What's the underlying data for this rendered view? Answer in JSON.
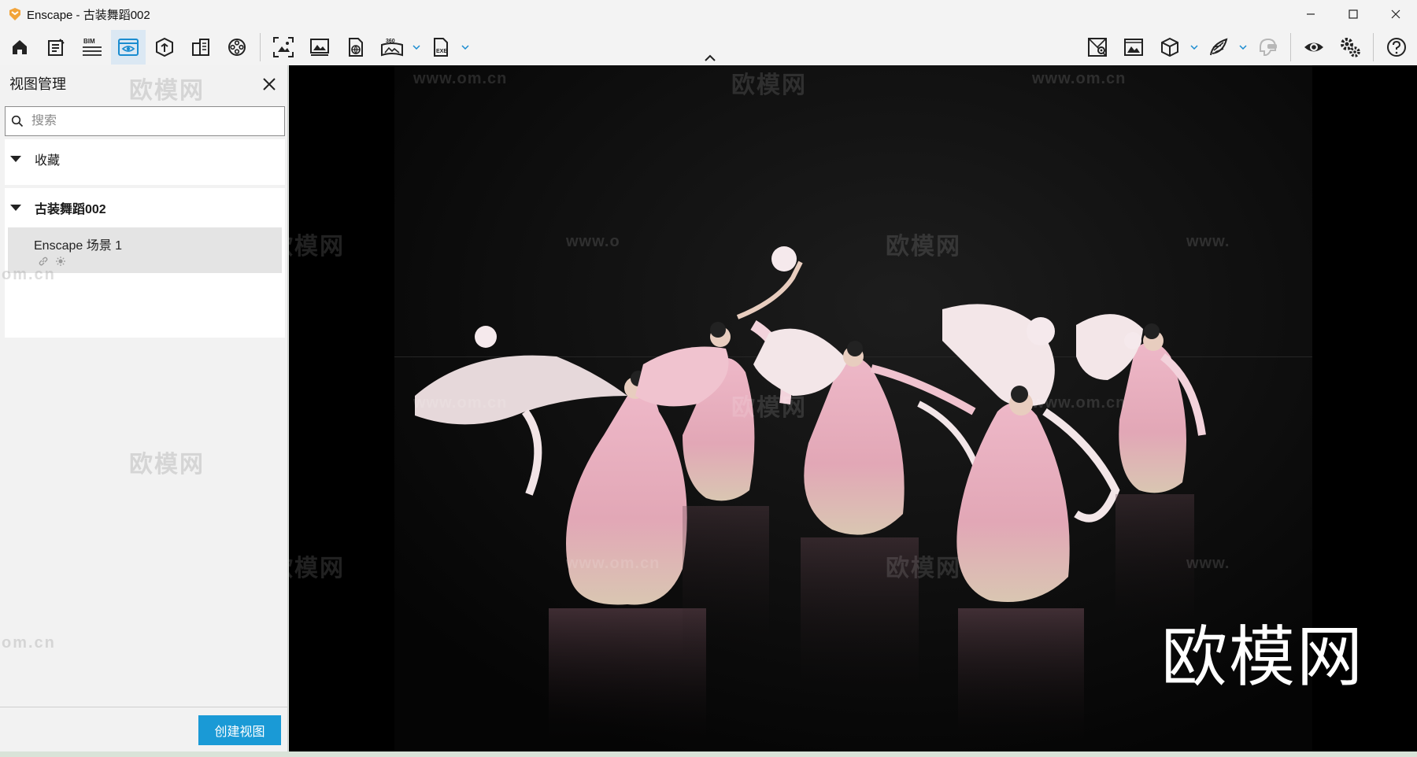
{
  "window": {
    "title": "Enscape - 古装舞蹈002"
  },
  "toolbar": {
    "left_buttons": [
      {
        "icon": "home-icon"
      },
      {
        "icon": "notes-icon"
      },
      {
        "icon": "bim-icon",
        "label": "BIM"
      },
      {
        "icon": "view-management-icon",
        "active": true
      },
      {
        "icon": "asset-library-icon"
      },
      {
        "icon": "material-editor-icon"
      },
      {
        "icon": "video-editor-icon"
      },
      {
        "icon": "screenshot-icon"
      },
      {
        "icon": "batch-render-icon"
      },
      {
        "icon": "export-web-icon"
      },
      {
        "icon": "panorama-360-icon",
        "label": "360"
      },
      {
        "icon": "export-exe-icon",
        "label": "EXE"
      }
    ],
    "right_buttons": [
      {
        "icon": "map-icon"
      },
      {
        "icon": "image-settings-icon"
      },
      {
        "icon": "cube-icon"
      },
      {
        "icon": "feather-icon"
      },
      {
        "icon": "vr-headset-icon"
      },
      {
        "icon": "eye-icon"
      },
      {
        "icon": "settings-icon"
      },
      {
        "icon": "help-icon"
      }
    ]
  },
  "panel": {
    "title": "视图管理",
    "search_placeholder": "搜索",
    "favorites_label": "收藏",
    "project_label": "古装舞蹈002",
    "views": [
      {
        "name": "Enscape 场景 1"
      }
    ],
    "create_button": "创建视图"
  },
  "viewport": {
    "watermark_text": "欧模网",
    "watermark_url": "www.om.cn",
    "watermark_url_fragment": "www.o",
    "watermark_url_partial": "om.cn",
    "watermark_www_partial": "www.",
    "brand_text": "欧模网"
  }
}
